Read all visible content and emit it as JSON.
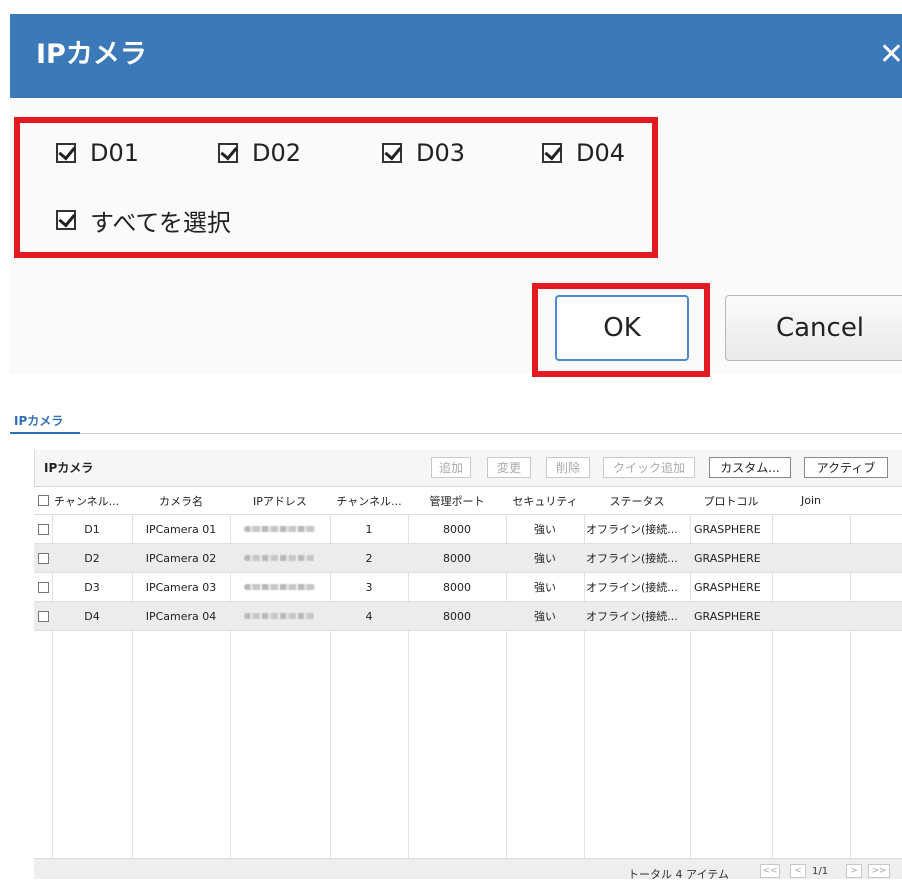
{
  "dialog": {
    "title": "IPカメラ",
    "close": "✕",
    "checkboxes": [
      {
        "label": "D01",
        "checked": true
      },
      {
        "label": "D02",
        "checked": true
      },
      {
        "label": "D03",
        "checked": true
      },
      {
        "label": "D04",
        "checked": true
      }
    ],
    "select_all": {
      "label": "すべてを選択",
      "checked": true
    },
    "ok_label": "OK",
    "cancel_label": "Cancel",
    "highlight_color": "#e21b23",
    "header_color": "#3c79b8"
  },
  "tab": {
    "label": "IPカメラ"
  },
  "panel": {
    "title": "IPカメラ",
    "toolbar": {
      "add": "追加",
      "edit": "変更",
      "delete": "削除",
      "quick_add": "クイック追加",
      "custom": "カスタム...",
      "active": "アクティブ"
    }
  },
  "table": {
    "columns": [
      "チャンネル...",
      "カメラ名",
      "IPアドレス",
      "チャンネル...",
      "管理ポート",
      "セキュリティ",
      "ステータス",
      "プロトコル",
      "Join"
    ],
    "rows": [
      {
        "channel": "D1",
        "name": "IPCamera 01",
        "channel_no": "1",
        "port": "8000",
        "security": "強い",
        "status": "オフライン(接続...",
        "protocol": "GRASPHERE",
        "join": ""
      },
      {
        "channel": "D2",
        "name": "IPCamera 02",
        "channel_no": "2",
        "port": "8000",
        "security": "強い",
        "status": "オフライン(接続...",
        "protocol": "GRASPHERE",
        "join": ""
      },
      {
        "channel": "D3",
        "name": "IPCamera 03",
        "channel_no": "3",
        "port": "8000",
        "security": "強い",
        "status": "オフライン(接続...",
        "protocol": "GRASPHERE",
        "join": ""
      },
      {
        "channel": "D4",
        "name": "IPCamera 04",
        "channel_no": "4",
        "port": "8000",
        "security": "強い",
        "status": "オフライン(接続...",
        "protocol": "GRASPHERE",
        "join": ""
      }
    ]
  },
  "footer": {
    "total": "トータル 4 アイテム",
    "first": "<<",
    "prev": "<",
    "page": "1/1",
    "next": ">",
    "last": ">>"
  }
}
